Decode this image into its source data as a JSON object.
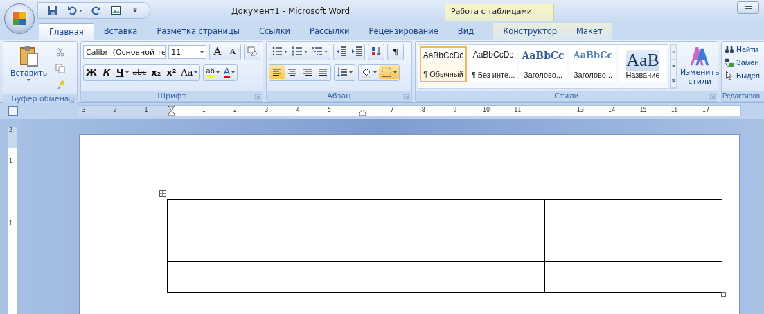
{
  "window": {
    "title": "Документ1 - Microsoft Word"
  },
  "contextual_group": {
    "title": "Работа с таблицами"
  },
  "tabs": [
    {
      "label": "Главная",
      "selected": true,
      "contextual": false
    },
    {
      "label": "Вставка",
      "selected": false,
      "contextual": false
    },
    {
      "label": "Разметка страницы",
      "selected": false,
      "contextual": false
    },
    {
      "label": "Ссылки",
      "selected": false,
      "contextual": false
    },
    {
      "label": "Рассылки",
      "selected": false,
      "contextual": false
    },
    {
      "label": "Рецензирование",
      "selected": false,
      "contextual": false
    },
    {
      "label": "Вид",
      "selected": false,
      "contextual": false
    },
    {
      "label": "Конструктор",
      "selected": false,
      "contextual": true
    },
    {
      "label": "Макет",
      "selected": false,
      "contextual": true
    }
  ],
  "clipboard": {
    "paste_label": "Вставить",
    "group_label": "Буфер обмена"
  },
  "font": {
    "font_name": "Calibri (Основной те",
    "font_size": "11",
    "grow": "A",
    "shrink": "A",
    "group_label": "Шрифт",
    "format_buttons": [
      {
        "label": "Ж",
        "kind": "bold"
      },
      {
        "label": "К",
        "kind": "italic"
      },
      {
        "label": "Ч",
        "kind": "underline"
      },
      {
        "label": "abc",
        "kind": "strike"
      },
      {
        "label": "x₂",
        "kind": "sub"
      },
      {
        "label": "x²",
        "kind": "sup"
      },
      {
        "label": "Aa",
        "kind": "case"
      }
    ],
    "highlight": "ab",
    "font_color": "A"
  },
  "paragraph": {
    "group_label": "Абзац",
    "show_marks": "¶",
    "align_buttons": [
      {
        "kind": "left",
        "selected": true
      },
      {
        "kind": "center",
        "selected": false
      },
      {
        "kind": "right",
        "selected": false
      },
      {
        "kind": "justify",
        "selected": false
      }
    ]
  },
  "styles": {
    "group_label": "Стили",
    "change_label": "Изменить стили",
    "items": [
      {
        "preview": "AaBbCcDc",
        "name": "¶ Обычный",
        "kind": "normal",
        "selected": true
      },
      {
        "preview": "AaBbCcDc",
        "name": "¶ Без инте...",
        "kind": "normal",
        "selected": false
      },
      {
        "preview": "AaBbCc",
        "name": "Заголово...",
        "kind": "heading1",
        "selected": false
      },
      {
        "preview": "AaBbCc",
        "name": "Заголово...",
        "kind": "heading2",
        "selected": false
      },
      {
        "preview": "AaB",
        "name": "Название",
        "kind": "title",
        "selected": false
      }
    ]
  },
  "editing": {
    "group_label": "Редактиров",
    "items": [
      {
        "label": "Найти",
        "kind": "find"
      },
      {
        "label": "Замен",
        "kind": "replace"
      },
      {
        "label": "Выдел",
        "kind": "select"
      }
    ]
  },
  "ruler": {
    "left_numbers": [
      "3",
      "2",
      "1"
    ],
    "segments": [
      [
        "1",
        "2",
        "3",
        "4",
        "5"
      ],
      [
        "7",
        "8",
        "9",
        "10",
        "11"
      ],
      [
        "13",
        "14",
        "15",
        "16",
        "17"
      ]
    ]
  },
  "vertical_ruler": {
    "numbers": [
      "2",
      "1",
      "1"
    ]
  }
}
